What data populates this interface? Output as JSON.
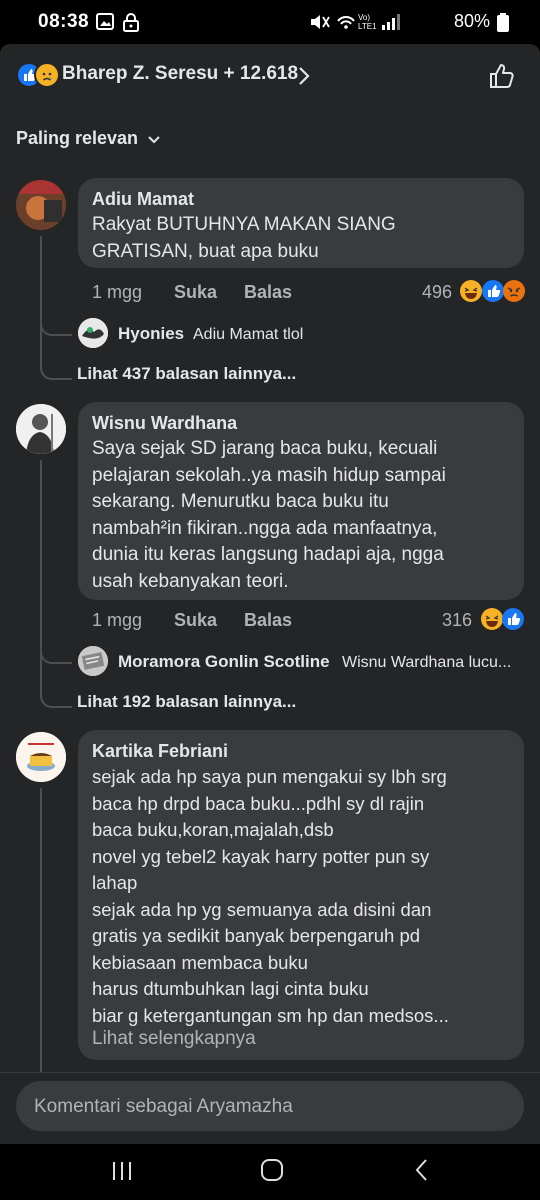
{
  "status_bar": {
    "time": "08:38",
    "battery": "80%"
  },
  "header": {
    "title": "Bharep Z. Seresu + 12.618"
  },
  "sort": {
    "label": "Paling relevan"
  },
  "comments": [
    {
      "author": "Adiu Mamat",
      "text": "Rakyat BUTUHNYA MAKAN SIANG\nGRATISAN, buat apa buku",
      "time": "1 mgg",
      "like_label": "Suka",
      "reply_label": "Balas",
      "reaction_count": "496",
      "reply": {
        "author": "Hyonies",
        "text": "Adiu Mamat tlol"
      },
      "more_replies": "Lihat 437 balasan lainnya..."
    },
    {
      "author": "Wisnu Wardhana",
      "text": "Saya sejak SD jarang baca buku, kecuali\npelajaran sekolah..ya masih hidup sampai\nsekarang. Menurutku baca buku itu\nnambah²in fikiran..ngga ada manfaatnya,\ndunia itu keras langsung hadapi aja, ngga\nusah kebanyakan teori.",
      "time": "1 mgg",
      "like_label": "Suka",
      "reply_label": "Balas",
      "reaction_count": "316",
      "reply": {
        "author": "Moramora Gonlin Scotline",
        "text": "Wisnu Wardhana lucu..."
      },
      "more_replies": "Lihat 192 balasan lainnya..."
    },
    {
      "author": "Kartika Febriani",
      "text": "sejak ada hp saya pun mengakui sy lbh srg\nbaca hp drpd baca buku...pdhl sy dl rajin\nbaca buku,koran,majalah,dsb\nnovel yg tebel2 kayak harry potter pun sy\nlahap\nsejak ada hp yg semuanya ada disini dan\ngratis ya sedikit banyak berpengaruh pd\nkebiasaan membaca buku\nharus dtumbuhkan lagi cinta buku\nbiar g ketergantungan sm hp dan medsos...",
      "see_more": "Lihat selengkapnya"
    }
  ],
  "composer": {
    "placeholder": "Komentari sebagai Aryamazha"
  },
  "colors": {
    "background": "#242526",
    "bubble": "#3a3b3c",
    "text": "#e4e6eb",
    "muted": "#b0b3b8",
    "like_blue": "#1877f2"
  }
}
